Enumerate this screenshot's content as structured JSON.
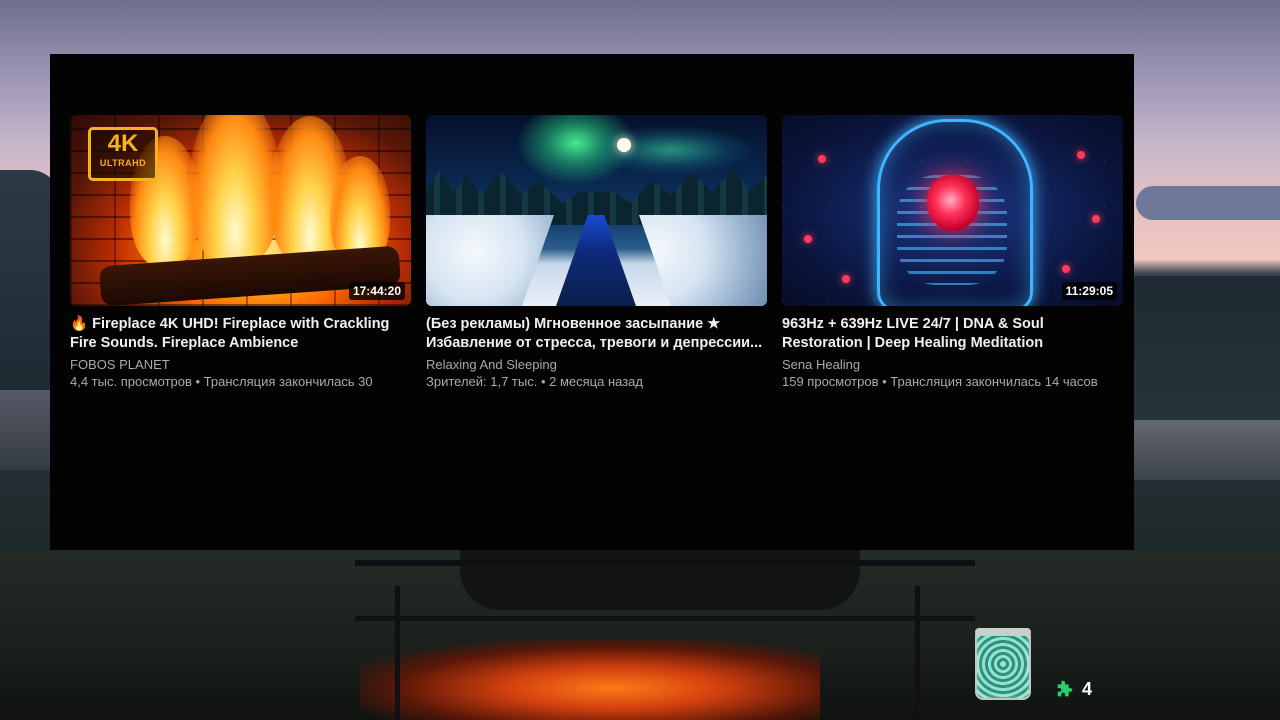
{
  "videos": [
    {
      "title": "🔥 Fireplace 4K UHD! Fireplace with Crackling Fire Sounds. Fireplace Ambience",
      "channel": "FOBOS PLANET",
      "meta": "4,4 тыс. просмотров • Трансляция закончилась 30",
      "duration": "17:44:20",
      "badge": {
        "main": "4K",
        "sub": "ULTRAHD"
      }
    },
    {
      "title": "(Без рекламы) Мгновенное засыпание ★ Избавление от стресса, тревоги и депрессии...",
      "channel": "Relaxing And Sleeping",
      "meta": "Зрителей: 1,7 тыс. • 2 месяца назад"
    },
    {
      "title": "963Hz + 639Hz LIVE 24/7 | DNA & Soul Restoration | Deep Healing Meditation",
      "channel": "Sena Healing",
      "meta": "159 просмотров • Трансляция закончилась 14 часов",
      "duration": "11:29:05"
    }
  ],
  "extension_badge": {
    "icon": "puzzle-icon",
    "count": "4",
    "color": "#2ecc71"
  }
}
